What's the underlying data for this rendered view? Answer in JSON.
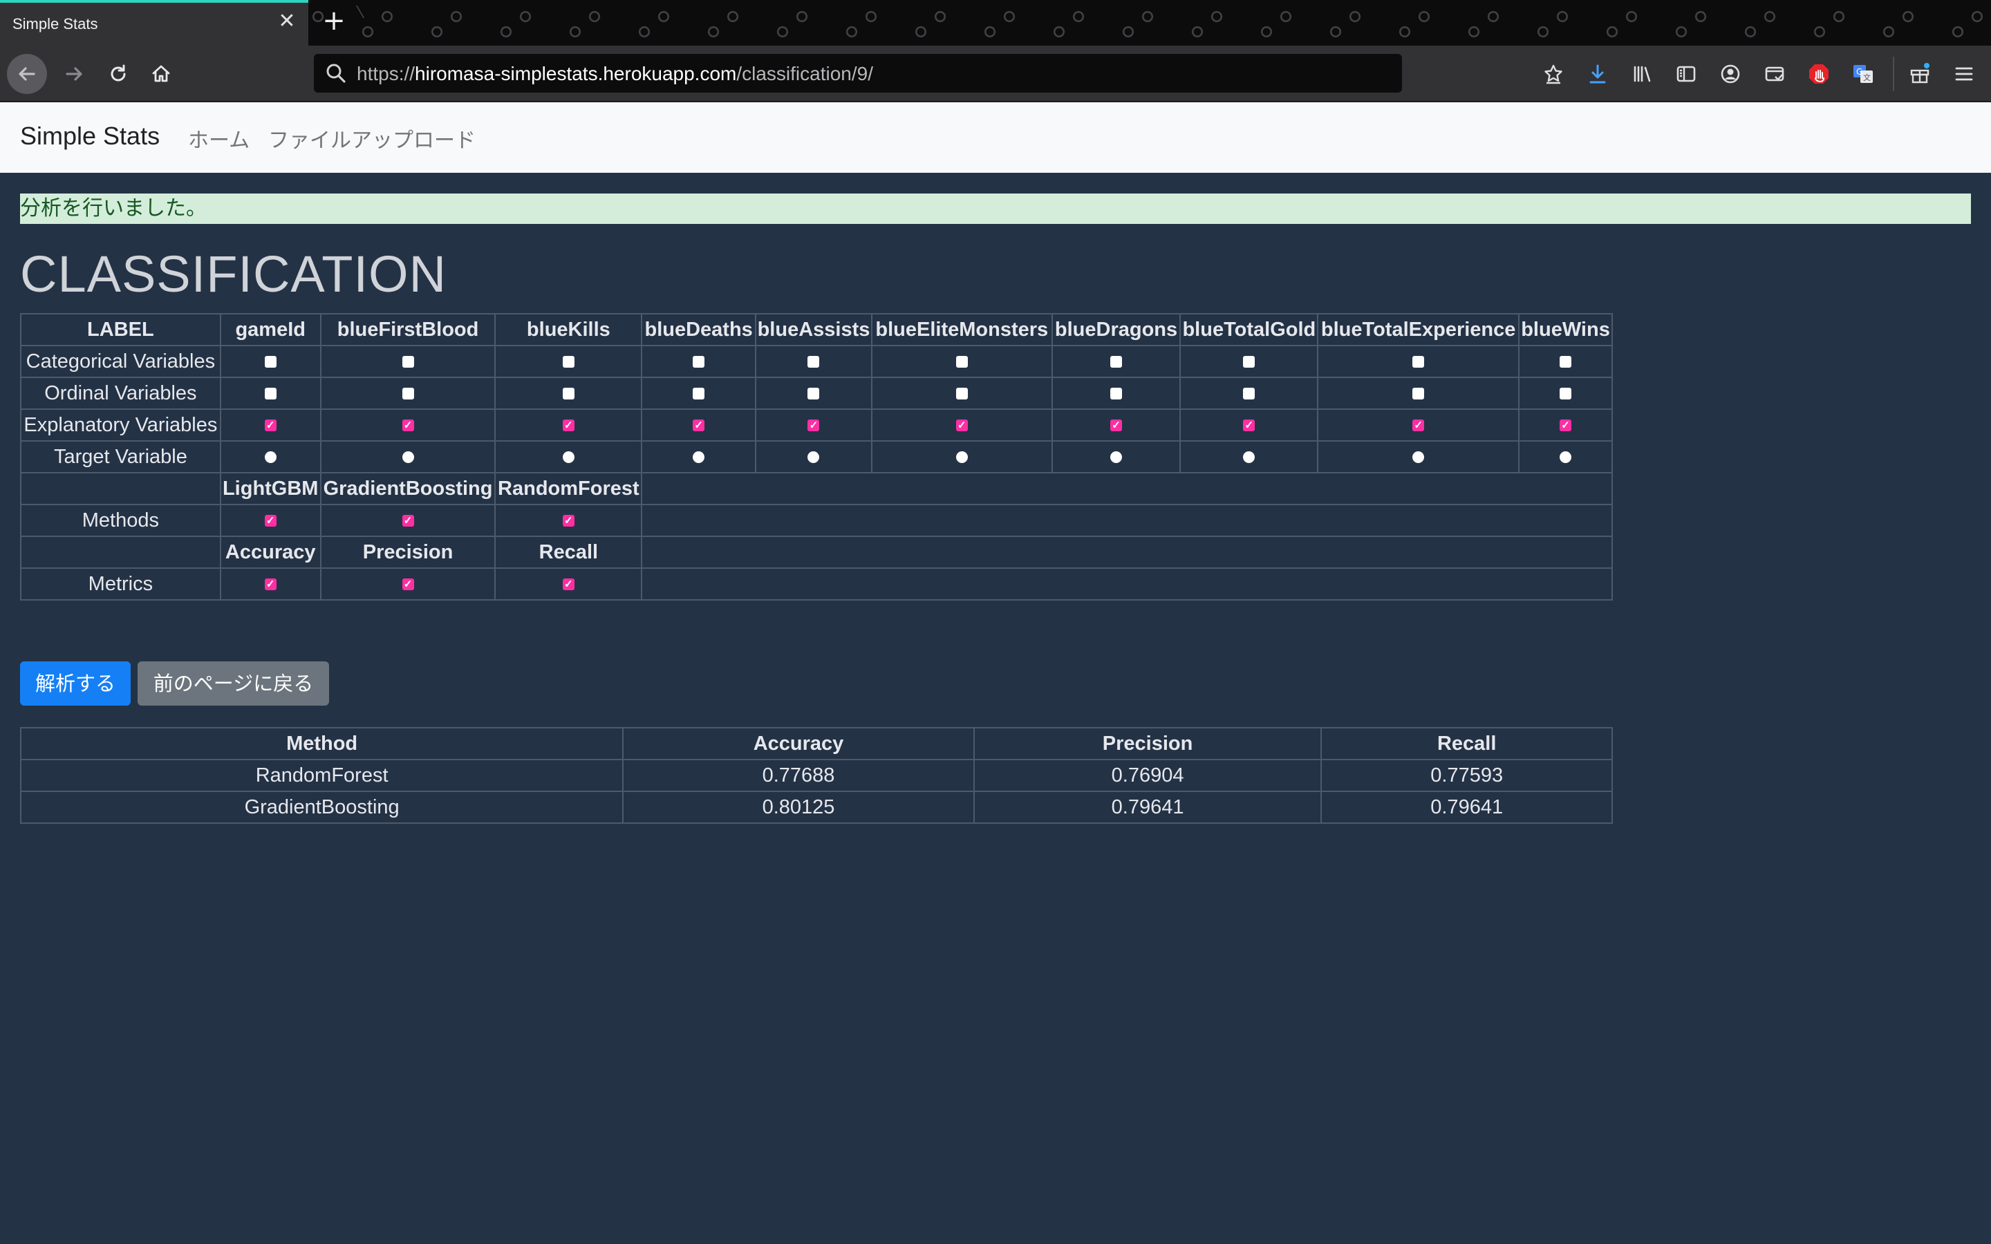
{
  "browser": {
    "tab_title": "Simple Stats",
    "tab_close": "✕",
    "new_tab": "+",
    "url_prefix": "https://",
    "url_host": "hiromasa-simplestats.herokuapp.com",
    "url_path": "/classification/9/"
  },
  "site": {
    "brand": "Simple Stats",
    "nav": [
      "ホーム",
      "ファイルアップロード"
    ]
  },
  "alert": "分析を行いました。",
  "title": "CLASSIFICATION",
  "config_table": {
    "header_label": "LABEL",
    "columns": [
      "gameId",
      "blueFirstBlood",
      "blueKills",
      "blueDeaths",
      "blueAssists",
      "blueEliteMonsters",
      "blueDragons",
      "blueTotalGold",
      "blueTotalExperience",
      "blueWins"
    ],
    "rows": {
      "categorical": "Categorical Variables",
      "ordinal": "Ordinal Variables",
      "explanatory": "Explanatory Variables",
      "target": "Target Variable"
    },
    "methods_header": [
      "LightGBM",
      "GradientBoosting",
      "RandomForest"
    ],
    "methods_label": "Methods",
    "metrics_header": [
      "Accuracy",
      "Precision",
      "Recall"
    ],
    "metrics_label": "Metrics"
  },
  "buttons": {
    "analyze": "解析する",
    "back": "前のページに戻る"
  },
  "results": {
    "headers": [
      "Method",
      "Accuracy",
      "Precision",
      "Recall"
    ],
    "rows": [
      [
        "RandomForest",
        "0.77688",
        "0.76904",
        "0.77593"
      ],
      [
        "GradientBoosting",
        "0.80125",
        "0.79641",
        "0.79641"
      ]
    ]
  }
}
